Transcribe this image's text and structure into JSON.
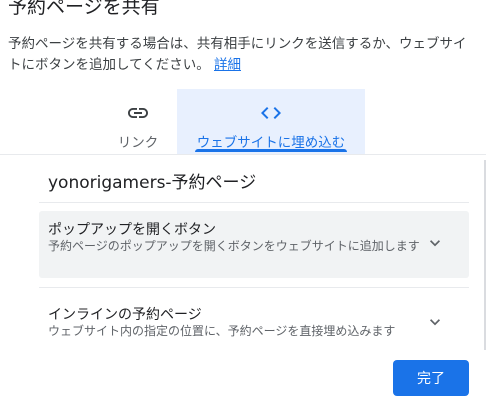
{
  "dialog": {
    "title": "予約ページを共有",
    "description": "予約ページを共有する場合は、共有相手にリンクを送信するか、ウェブサイトにボタンを追加してください。",
    "details_link": "詳細"
  },
  "tabs": [
    {
      "label": "リンク",
      "icon": "link-icon",
      "selected": false
    },
    {
      "label": "ウェブサイトに埋め込む",
      "icon": "code-icon",
      "selected": true
    }
  ],
  "page_name": "yonorigamers-予約ページ",
  "options": [
    {
      "title": "ポップアップを開くボタン",
      "description": "予約ページのポップアップを開くボタンをウェブサイトに追加します",
      "icon": "chevron-down-icon",
      "selected": true
    },
    {
      "title": "インラインの予約ページ",
      "description": "ウェブサイト内の指定の位置に、予約ページを直接埋め込みます",
      "icon": "chevron-down-icon",
      "selected": false
    }
  ],
  "done_label": "完了",
  "colors": {
    "accent": "#1a73e8",
    "selected_tab_bg": "#e8f0fe",
    "selected_option_bg": "#f1f3f4"
  }
}
